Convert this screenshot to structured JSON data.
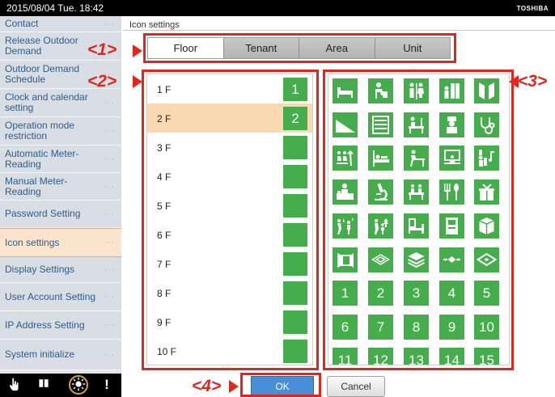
{
  "topbar": {
    "datetime": "2015/08/04 Tue. 18:42",
    "brand": "TOSHIBA"
  },
  "sidebar": {
    "items": [
      {
        "label": "Contact",
        "active": false
      },
      {
        "label": "Release Outdoor Demand",
        "active": false
      },
      {
        "label": "Outdoor Demand Schedule",
        "active": false
      },
      {
        "label": "Clock and calendar setting",
        "active": false
      },
      {
        "label": "Operation mode restriction",
        "active": false
      },
      {
        "label": "Automatic Meter-Reading",
        "active": false
      },
      {
        "label": "Manual Meter-Reading",
        "active": false
      },
      {
        "label": "Password Setting",
        "active": false
      },
      {
        "label": "Icon settings",
        "active": true
      },
      {
        "label": "Display Settings",
        "active": false
      },
      {
        "label": "User Account Setting",
        "active": false
      },
      {
        "label": "IP Address Setting",
        "active": false
      },
      {
        "label": "System initialize",
        "active": false
      }
    ],
    "more_dots": "···"
  },
  "bottom_bar": {
    "icons": [
      "touch-hand-icon",
      "book-icon",
      "sun-icon",
      "alert-icon"
    ]
  },
  "main": {
    "title": "Icon settings",
    "tabs": [
      {
        "label": "Floor",
        "active": true
      },
      {
        "label": "Tenant",
        "active": false
      },
      {
        "label": "Area",
        "active": false
      },
      {
        "label": "Unit",
        "active": false
      }
    ],
    "floors": [
      {
        "name": "1 F",
        "badge": "1",
        "selected": false
      },
      {
        "name": "2 F",
        "badge": "2",
        "selected": true
      },
      {
        "name": "3 F",
        "badge": "",
        "selected": false
      },
      {
        "name": "4 F",
        "badge": "",
        "selected": false
      },
      {
        "name": "5 F",
        "badge": "",
        "selected": false
      },
      {
        "name": "6 F",
        "badge": "",
        "selected": false
      },
      {
        "name": "7 F",
        "badge": "",
        "selected": false
      },
      {
        "name": "8 F",
        "badge": "",
        "selected": false
      },
      {
        "name": "9 F",
        "badge": "",
        "selected": false
      },
      {
        "name": "10 F",
        "badge": "",
        "selected": false
      }
    ],
    "icon_grid": [
      [
        "bed-icon",
        "elder-care-icon",
        "restroom-icon",
        "elevator-person-icon",
        "door-icon"
      ],
      [
        "slope-icon",
        "window-frame-icon",
        "office-desk-icon",
        "chef-icon",
        "stethoscope-icon"
      ],
      [
        "waiting-room-icon",
        "hospital-bed-icon",
        "study-desk-icon",
        "presentation-icon",
        "music-room-icon"
      ],
      [
        "reception-icon",
        "microscope-icon",
        "meeting-table-icon",
        "restaurant-icon",
        "gift-icon"
      ],
      [
        "outdoor-people-icon",
        "park-family-icon",
        "lounge-icon",
        "building-icon",
        "box-icon"
      ],
      [
        "room-panel-icon",
        "diamond-outline-icon",
        "layers-icon",
        "diamond-arrows-icon",
        "diamond-fill-icon"
      ],
      [
        "1",
        "2",
        "3",
        "4",
        "5"
      ],
      [
        "6",
        "7",
        "8",
        "9",
        "10"
      ],
      [
        "11",
        "12",
        "13",
        "14",
        "15"
      ]
    ],
    "ok_label": "OK",
    "cancel_label": "Cancel"
  },
  "annotations": {
    "callout_1": "<1>",
    "callout_2": "<2>",
    "callout_3": "<3>",
    "callout_4": "<4>"
  },
  "colors": {
    "accent_green": "#46ad4c",
    "annotation_red": "#e0261d",
    "selection_peach": "#fbd9b3",
    "sidebar_text": "#2d5b8c",
    "ok_blue": "#4a8fd6"
  }
}
